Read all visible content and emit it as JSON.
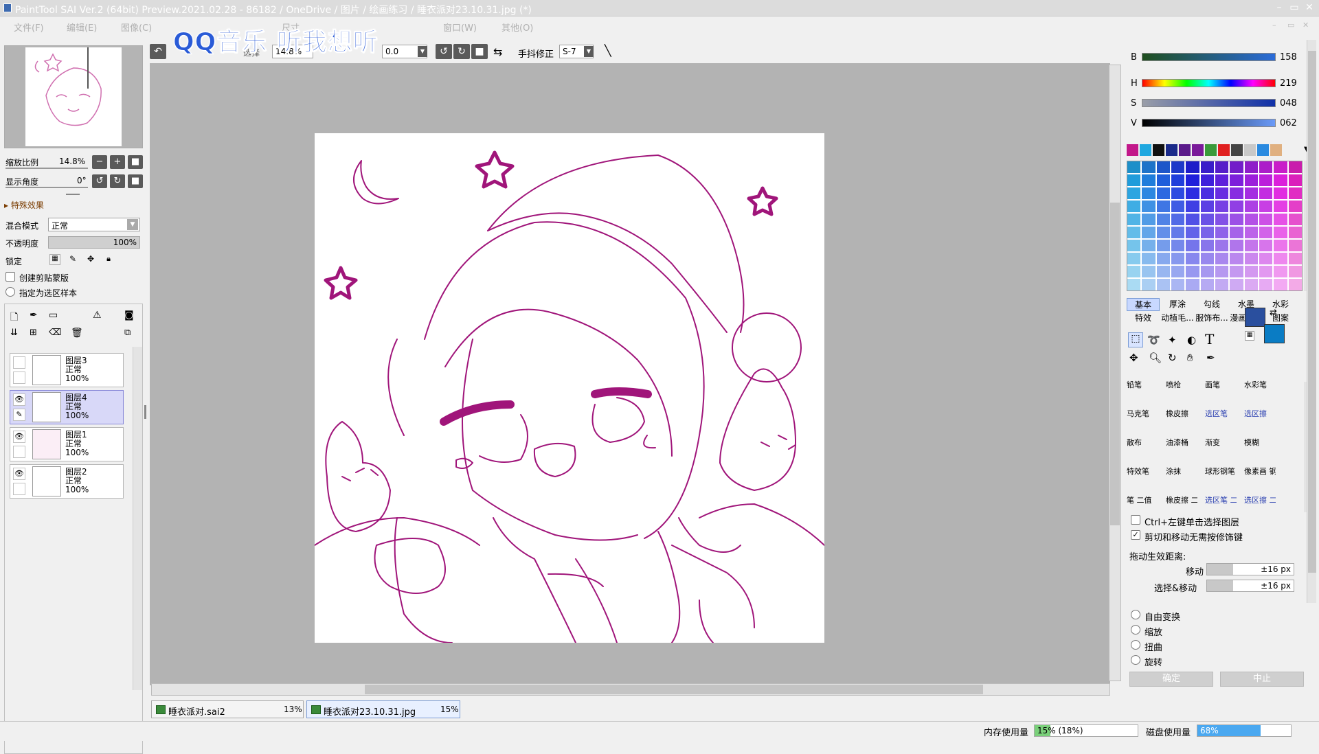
{
  "app": {
    "title": "PaintTool SAI Ver.2 (64bit) Preview.2021.02.28 - 86182 / OneDrive / 图片 / 绘画练习 / 睡衣派对23.10.31.jpg (*)",
    "overlay_text": "QQ音乐 听我想听"
  },
  "menu": [
    "文件(F)",
    "编辑(E)",
    "图像(C)",
    "尺寸",
    "窗口(W)",
    "其他(O)"
  ],
  "navigator": {
    "zoom_label": "缩放比例",
    "zoom_value": "14.8%",
    "angle_label": "显示角度",
    "angle_value": "0°"
  },
  "layer_props": {
    "section": "特殊效果",
    "blend_label": "混合模式",
    "blend_value": "正常",
    "opacity_label": "不透明度",
    "opacity_value": "100%",
    "lock_label": "锁定",
    "clip_label": "创建剪贴蒙版",
    "sample_label": "指定为选区样本"
  },
  "layers": [
    {
      "name": "图层3",
      "mode": "正常",
      "opacity": "100%",
      "visible": false,
      "selected": false
    },
    {
      "name": "图层4",
      "mode": "正常",
      "opacity": "100%",
      "visible": true,
      "selected": true
    },
    {
      "name": "图层1",
      "mode": "正常",
      "opacity": "100%",
      "visible": true,
      "selected": false
    },
    {
      "name": "图层2",
      "mode": "正常",
      "opacity": "100%",
      "visible": true,
      "selected": false
    }
  ],
  "toolbar": {
    "zoom_label": "选择",
    "zoom_value": "14.8%",
    "angle_value": "0.0",
    "stabilizer_label": "手抖修正",
    "stabilizer_value": "S-7"
  },
  "tabs": [
    {
      "name": "睡衣派对.sai2",
      "percent": "13%",
      "active": false
    },
    {
      "name": "睡衣派对23.10.31.jpg",
      "percent": "15%",
      "active": true
    }
  ],
  "color": {
    "B": "158",
    "H": "219",
    "S": "048",
    "V": "062",
    "B_label": "B",
    "H_label": "H",
    "S_label": "S",
    "V_label": "V",
    "primary": "#2a4f9e",
    "secondary": "#0a7cc4",
    "line_color": "#a0157a",
    "swatches": [
      "#c2188a",
      "#20a8e0",
      "#111111",
      "#1a2a8a",
      "#5a1a8a",
      "#7a1a9a",
      "#3a9a3a",
      "#e02020",
      "#444444",
      "#c8c8c8",
      "#2a8ae0",
      "#e0b080"
    ]
  },
  "brush_tabs": [
    [
      "基本",
      "厚涂",
      "勾线",
      "水墨",
      "水彩"
    ],
    [
      "特效",
      "动植毛...",
      "服饰布...",
      "漫画网...",
      "图案"
    ]
  ],
  "brushes": [
    [
      "铅笔",
      "喷枪",
      "画笔",
      "水彩笔"
    ],
    [
      "马克笔",
      "橡皮擦",
      "选区笔",
      "选区擦"
    ],
    [
      "散布",
      "油漆桶",
      "渐变",
      "模糊"
    ],
    [
      "特效笔",
      "涂抹",
      "球形钢笔",
      "像素画 钢笔"
    ],
    [
      "笔 二值",
      "橡皮擦 二值",
      "选区笔 二值",
      "选区擦 二值"
    ]
  ],
  "options": {
    "ctrl_click": "Ctrl+左键单击选择图层",
    "cut_move": "剪切和移动无需按修饰键",
    "drag_label": "拖动生效距离:",
    "move_label": "移动",
    "move_value": "±16 px",
    "selmove_label": "选择&移动",
    "selmove_value": "±16 px",
    "free_transform": "自由变换",
    "scale": "缩放",
    "distort": "扭曲",
    "rotate": "旋转",
    "ok": "确定",
    "cancel": "中止"
  },
  "status": {
    "mem_label": "内存使用量",
    "mem_value": "15% (18%)",
    "mem_fill": 0.15,
    "disk_label": "磁盘使用量",
    "disk_value": "68%",
    "disk_fill": 0.68
  }
}
